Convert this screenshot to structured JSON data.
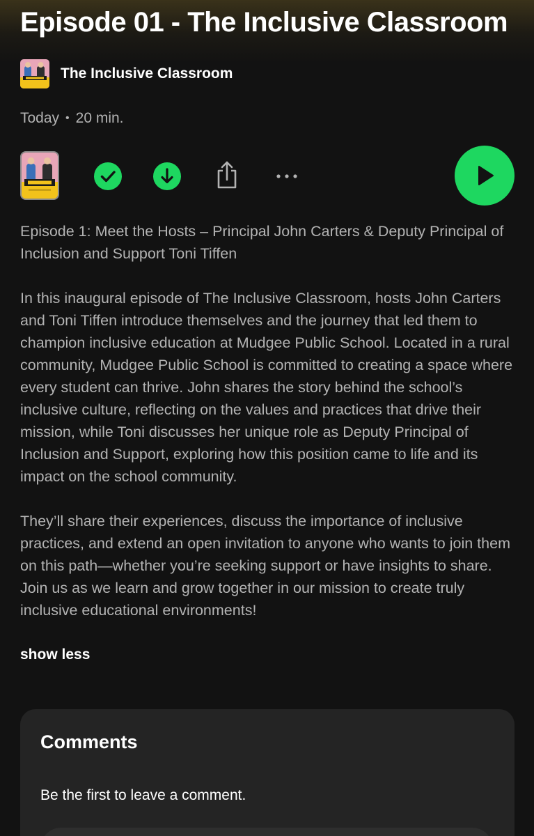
{
  "episode": {
    "title": "Episode 01 - The Inclusive Classroom",
    "show_name": "The Inclusive Classroom",
    "date": "Today",
    "separator": "•",
    "duration": "20 min."
  },
  "controls": {
    "icons": [
      "episode-cover",
      "check-icon",
      "download-icon",
      "share-icon",
      "more-icon",
      "play-icon"
    ],
    "accent_color": "#1ed760"
  },
  "description": {
    "paragraphs": [
      "Episode 1: Meet the Hosts – Principal John Carters & Deputy Principal of Inclusion and Support Toni Tiffen",
      "In this inaugural episode of The Inclusive Classroom, hosts John Carters and Toni Tiffen introduce themselves and the journey that led them to champion inclusive education at Mudgee Public School. Located in a rural community, Mudgee Public School is committed to creating a space where every student can thrive. John shares the story behind the school’s inclusive culture, reflecting on the values and practices that drive their mission, while Toni discusses her unique role as Deputy Principal of Inclusion and Support, exploring how this position came to life and its impact on the school community.",
      "They’ll share their experiences, discuss the importance of inclusive practices, and extend an open invitation to anyone who wants to join them on this path—whether you’re seeking support or have insights to share. Join us as we learn and grow together in our mission to create truly inclusive educational environments!"
    ],
    "toggle_label": "show less"
  },
  "comments": {
    "title": "Comments",
    "empty_text": "Be the first to leave a comment."
  }
}
